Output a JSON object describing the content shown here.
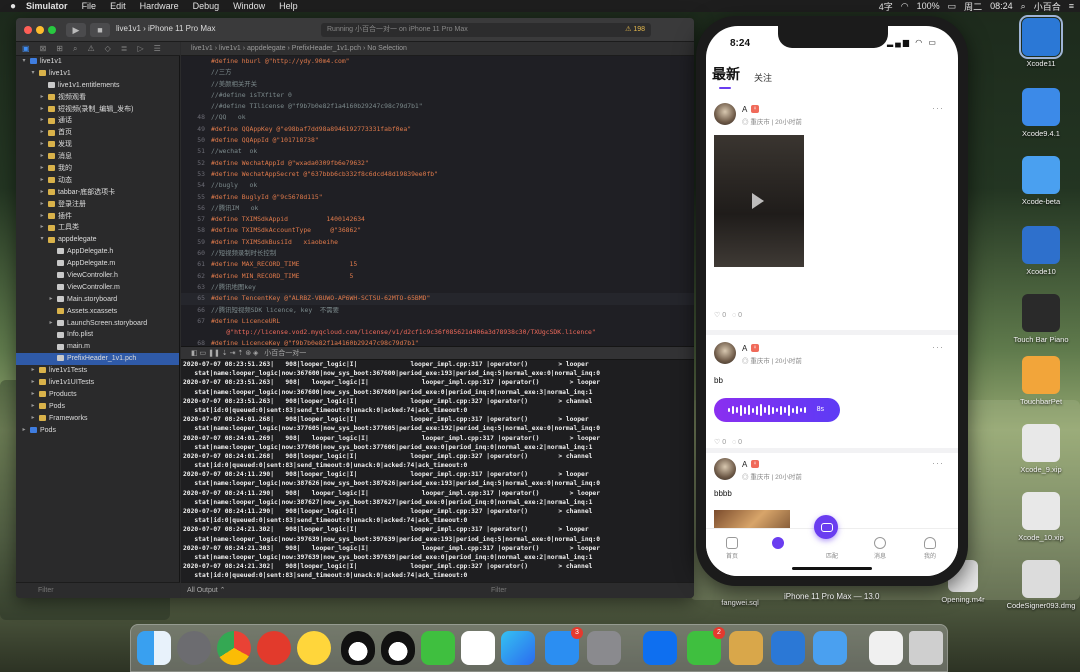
{
  "menubar": {
    "apple": "",
    "app": "Simulator",
    "items": [
      "File",
      "Edit",
      "Hardware",
      "Debug",
      "Window",
      "Help"
    ],
    "status": {
      "input": "4字",
      "battery": "100%",
      "date": "周二",
      "time": "08:24",
      "user": "小百合"
    }
  },
  "xcode": {
    "scheme_project": "live1v1",
    "scheme_device": "iPhone 11 Pro Max",
    "activity": "Running 小百合一对一 on iPhone 11 Pro Max",
    "warnings": "⚠ 198",
    "jumpbar": "live1v1  ›  live1v1  ›  appdelegate  ›  PrefixHeader_1v1.pch  ›  No Selection",
    "navigator": [
      {
        "label": "live1v1",
        "depth": 0,
        "arrow": "▾",
        "kind": "proj"
      },
      {
        "label": "live1v1",
        "depth": 1,
        "arrow": "▾",
        "kind": "fold"
      },
      {
        "label": "live1v1.entitlements",
        "depth": 2,
        "arrow": "",
        "kind": "fil"
      },
      {
        "label": "视频观看",
        "depth": 2,
        "arrow": "▸",
        "kind": "fold"
      },
      {
        "label": "短视频(录制_编辑_发布)",
        "depth": 2,
        "arrow": "▸",
        "kind": "fold"
      },
      {
        "label": "通话",
        "depth": 2,
        "arrow": "▸",
        "kind": "fold"
      },
      {
        "label": "首页",
        "depth": 2,
        "arrow": "▸",
        "kind": "fold"
      },
      {
        "label": "发现",
        "depth": 2,
        "arrow": "▸",
        "kind": "fold"
      },
      {
        "label": "消息",
        "depth": 2,
        "arrow": "▸",
        "kind": "fold"
      },
      {
        "label": "我的",
        "depth": 2,
        "arrow": "▸",
        "kind": "fold"
      },
      {
        "label": "动态",
        "depth": 2,
        "arrow": "▸",
        "kind": "fold"
      },
      {
        "label": "tabbar-底部选项卡",
        "depth": 2,
        "arrow": "▸",
        "kind": "fold"
      },
      {
        "label": "登录注册",
        "depth": 2,
        "arrow": "▸",
        "kind": "fold"
      },
      {
        "label": "插件",
        "depth": 2,
        "arrow": "▸",
        "kind": "fold"
      },
      {
        "label": "工具类",
        "depth": 2,
        "arrow": "▸",
        "kind": "fold"
      },
      {
        "label": "appdelegate",
        "depth": 2,
        "arrow": "▾",
        "kind": "fold"
      },
      {
        "label": "AppDelegate.h",
        "depth": 3,
        "arrow": "",
        "kind": "fil"
      },
      {
        "label": "AppDelegate.m",
        "depth": 3,
        "arrow": "",
        "kind": "fil"
      },
      {
        "label": "ViewController.h",
        "depth": 3,
        "arrow": "",
        "kind": "fil"
      },
      {
        "label": "ViewController.m",
        "depth": 3,
        "arrow": "",
        "kind": "fil"
      },
      {
        "label": "Main.storyboard",
        "depth": 3,
        "arrow": "▸",
        "kind": "fil"
      },
      {
        "label": "Assets.xcassets",
        "depth": 3,
        "arrow": "",
        "kind": "fold"
      },
      {
        "label": "LaunchScreen.storyboard",
        "depth": 3,
        "arrow": "▸",
        "kind": "fil"
      },
      {
        "label": "Info.plist",
        "depth": 3,
        "arrow": "",
        "kind": "fil"
      },
      {
        "label": "main.m",
        "depth": 3,
        "arrow": "",
        "kind": "fil"
      },
      {
        "label": "PrefixHeader_1v1.pch",
        "depth": 3,
        "arrow": "",
        "kind": "fil",
        "selected": true
      },
      {
        "label": "live1v1Tests",
        "depth": 1,
        "arrow": "▸",
        "kind": "fold"
      },
      {
        "label": "live1v1UITests",
        "depth": 1,
        "arrow": "▸",
        "kind": "fold"
      },
      {
        "label": "Products",
        "depth": 1,
        "arrow": "▸",
        "kind": "fold"
      },
      {
        "label": "Pods",
        "depth": 1,
        "arrow": "▸",
        "kind": "fold"
      },
      {
        "label": "Frameworks",
        "depth": 1,
        "arrow": "▸",
        "kind": "fold"
      },
      {
        "label": "Pods",
        "depth": 0,
        "arrow": "▸",
        "kind": "proj"
      }
    ],
    "nav_filter": "Filter",
    "code": [
      {
        "ln": "",
        "t": "#define hburl @\"http://ydy.90m4.com\"",
        "c": "def"
      },
      {
        "ln": "",
        "t": "//三方",
        "c": "comment"
      },
      {
        "ln": "",
        "t": "//美颜相关开关",
        "c": "comment"
      },
      {
        "ln": "",
        "t": "//#define isTXfiter 0",
        "c": "comment"
      },
      {
        "ln": "",
        "t": "//#define TIlicense @\"f9b7b0e82f1a4160b29247c98c79d7b1\"",
        "c": "comment"
      },
      {
        "ln": "48",
        "t": "//QQ   ok",
        "c": "comment"
      },
      {
        "ln": "49",
        "t": "#define QQAppKey @\"e98baf7dd98a8946192773331fabf0ea\"",
        "c": "def"
      },
      {
        "ln": "50",
        "t": "#define QQAppId @\"101718738\"",
        "c": "def"
      },
      {
        "ln": "51",
        "t": "//wechat  ok",
        "c": "comment"
      },
      {
        "ln": "52",
        "t": "#define WechatAppId @\"wxada0309fb6e79632\"",
        "c": "def"
      },
      {
        "ln": "53",
        "t": "#define WechatAppSecret @\"637bbb6cb332f8c6dcd48d19839ee0fb\"",
        "c": "def"
      },
      {
        "ln": "54",
        "t": "//bugly   ok",
        "c": "comment"
      },
      {
        "ln": "55",
        "t": "#define BuglyId @\"9c5678d115\"",
        "c": "def"
      },
      {
        "ln": "56",
        "t": "//腾讯IM   ok",
        "c": "comment"
      },
      {
        "ln": "57",
        "t": "#define TXIMSdkAppid          1400142634",
        "c": "def"
      },
      {
        "ln": "58",
        "t": "#define TXIMSdkAccountType     @\"36862\"",
        "c": "def"
      },
      {
        "ln": "59",
        "t": "#define TXIMSdkBusiId   xiaobeihe",
        "c": "def"
      },
      {
        "ln": "60",
        "t": "//短视频录制时长控制",
        "c": "comment"
      },
      {
        "ln": "61",
        "t": "#define MAX_RECORD_TIME             15",
        "c": "def"
      },
      {
        "ln": "62",
        "t": "#define MIN_RECORD_TIME             5",
        "c": "def"
      },
      {
        "ln": "63",
        "t": "//腾讯地图key",
        "c": "comment"
      },
      {
        "ln": "65",
        "t": "#define TencentKey @\"ALRBZ-VBUWO-AP6WH-SCTSU-62MTO-65BMD\"",
        "c": "def",
        "hl": true
      },
      {
        "ln": "66",
        "t": "//腾讯短视频SDK licence, key  不需要",
        "c": "comment"
      },
      {
        "ln": "67",
        "t": "#define LicenceURL",
        "c": "def"
      },
      {
        "ln": "",
        "t": "    @\"http://license.vod2.myqcloud.com/license/v1/d2cf1c9c36f085621d406a3d78938c30/TXUgcSDK.licence\"",
        "c": "str"
      },
      {
        "ln": "68",
        "t": "#define LicenceKey @\"f9b7b0e82f1a4160b29247c98c79d7b1\"",
        "c": "def"
      }
    ],
    "debug_target": "小百合一对一",
    "console": [
      "2020-07-07 08:23:51.263|   908|looper_logic|I|              looper_impl.cpp:317 |operator()        > looper",
      "   stat|name:looper_logic|now:367600|now_sys_boot:367600|period_exe:193|period_inq:5|normal_exe:0|normal_inq:0",
      "2020-07-07 08:23:51.263|   908|   looper_logic|I|              looper_impl.cpp:317 |operator()        > looper",
      "   stat|name:looper_logic|now:367600|now_sys_boot:367600|period_exe:0|period_inq:0|normal_exe:3|normal_inq:1",
      "2020-07-07 08:23:51.263|   908|looper_logic|I|              looper_impl.cpp:327 |operator()        > channel",
      "   stat|id:0|queued:0|sent:83|send_timeout:0|unack:0|acked:74|ack_timeout:0",
      "2020-07-07 08:24:01.268|   908|looper_logic|I|              looper_impl.cpp:317 |operator()        > looper",
      "   stat|name:looper_logic|now:377605|now_sys_boot:377605|period_exe:192|period_inq:5|normal_exe:0|normal_inq:0",
      "2020-07-07 08:24:01.269|   908|   looper_logic|I|              looper_impl.cpp:317 |operator()        > looper",
      "   stat|name:looper_logic|now:377606|now_sys_boot:377606|period_exe:0|period_inq:0|normal_exe:2|normal_inq:1",
      "2020-07-07 08:24:01.268|   908|looper_logic|I|              looper_impl.cpp:327 |operator()        > channel",
      "   stat|id:0|queued:0|sent:83|send_timeout:0|unack:0|acked:74|ack_timeout:0",
      "2020-07-07 08:24:11.290|   908|looper_logic|I|              looper_impl.cpp:317 |operator()        > looper",
      "   stat|name:looper_logic|now:387626|now_sys_boot:387626|period_exe:193|period_inq:5|normal_exe:0|normal_inq:0",
      "2020-07-07 08:24:11.290|   908|   looper_logic|I|              looper_impl.cpp:317 |operator()        > looper",
      "   stat|name:looper_logic|now:387627|now_sys_boot:387627|period_exe:0|period_inq:0|normal_exe:2|normal_inq:1",
      "2020-07-07 08:24:11.290|   908|looper_logic|I|              looper_impl.cpp:327 |operator()        > channel",
      "   stat|id:0|queued:0|sent:83|send_timeout:0|unack:0|acked:74|ack_timeout:0",
      "2020-07-07 08:24:21.302|   908|looper_logic|I|              looper_impl.cpp:317 |operator()        > looper",
      "   stat|name:looper_logic|now:397639|now_sys_boot:397639|period_exe:193|period_inq:5|normal_exe:0|normal_inq:0",
      "2020-07-07 08:24:21.303|   908|   looper_logic|I|              looper_impl.cpp:317 |operator()        > looper",
      "   stat|name:looper_logic|now:397639|now_sys_boot:397639|period_exe:0|period_inq:0|normal_exe:2|normal_inq:1",
      "2020-07-07 08:24:21.302|   908|looper_logic|I|              looper_impl.cpp:327 |operator()        > channel",
      "   stat|id:0|queued:0|sent:83|send_timeout:0|unack:0|acked:74|ack_timeout:0"
    ],
    "all_output": "All Output ⌃",
    "console_filter": "Filter"
  },
  "desktop": [
    {
      "label": "Xcode11",
      "color": "#2b78d6",
      "selected": true
    },
    {
      "label": "Xcode9.4.1",
      "color": "#3c8ae8"
    },
    {
      "label": "Xcode-beta",
      "color": "#4aa0f0"
    },
    {
      "label": "Xcode10",
      "color": "#2e70cc"
    },
    {
      "label": "Touch Bar Piano",
      "color": "#2a2a2a"
    },
    {
      "label": "TouchbarPet",
      "color": "#f2a53a"
    },
    {
      "label": "Xcode_9.xip",
      "color": "#e8e8e8"
    },
    {
      "label": "Xcode_10.xip",
      "color": "#e8e8e8"
    },
    {
      "label": "CodeSigner093.dmg",
      "color": "#dcdcdc"
    }
  ],
  "desktop_bottom": [
    {
      "label": "fangwei.sql"
    },
    {
      "label": "Opening.m4r"
    }
  ],
  "phone": {
    "time": "8:24",
    "tabs": {
      "latest": "最新",
      "follow": "关注"
    },
    "posts": [
      {
        "name": "A",
        "city": "重庆市",
        "ago": "20小时前",
        "likes": "0",
        "comments": "0"
      },
      {
        "name": "A",
        "city": "重庆市",
        "ago": "20小时前",
        "text": "bb",
        "voice": "8s",
        "likes": "0",
        "comments": "0"
      },
      {
        "name": "A",
        "city": "重庆市",
        "ago": "20小时前",
        "text": "bbbb"
      }
    ],
    "tabbar": [
      "首页",
      "",
      "匹配",
      "消息",
      "我的"
    ]
  },
  "sim_label": "iPhone 11 Pro Max — 13.0",
  "dock": {
    "badges": {
      "appstore": "3",
      "wechat_msg": "2"
    }
  }
}
